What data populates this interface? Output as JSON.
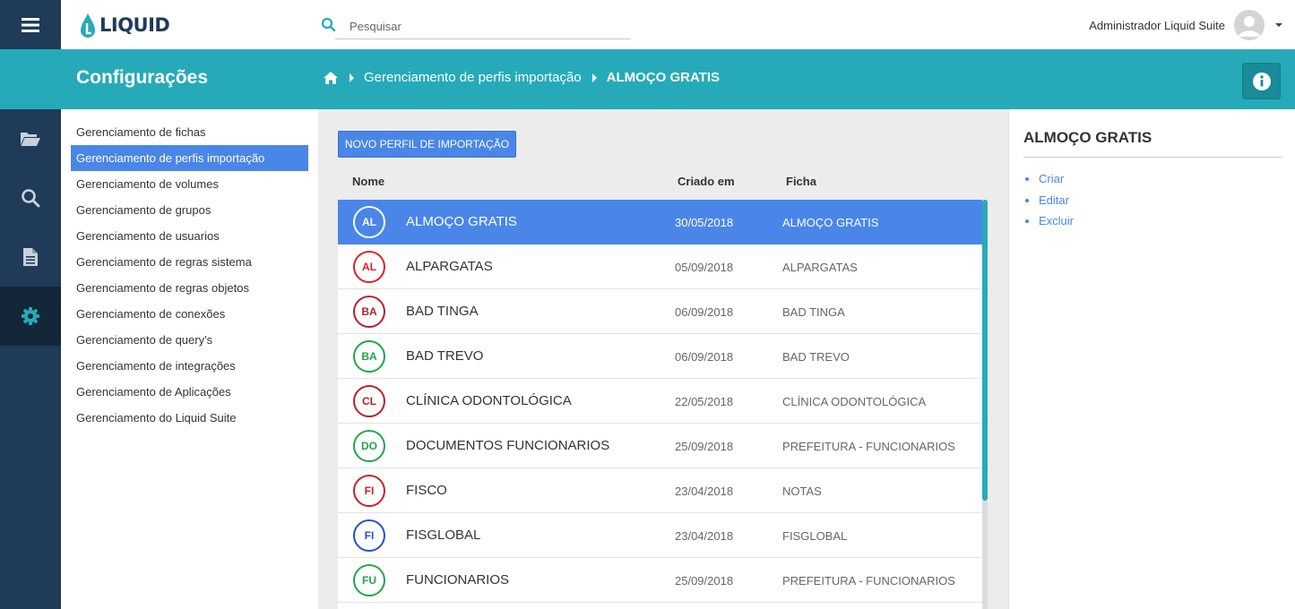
{
  "app": {
    "logo_text": "LIQUID"
  },
  "search": {
    "placeholder": "Pesquisar"
  },
  "user": {
    "name": "Administrador Liquid Suite"
  },
  "header": {
    "title": "Configurações",
    "breadcrumb": [
      "Gerenciamento de perfis importação",
      "ALMOÇO GRATIS"
    ]
  },
  "rail": [
    {
      "icon": "folder-icon"
    },
    {
      "icon": "search-icon"
    },
    {
      "icon": "document-icon"
    },
    {
      "icon": "gear-icon",
      "active": true
    }
  ],
  "submenu": [
    "Gerenciamento de fichas",
    "Gerenciamento de perfis importação",
    "Gerenciamento de volumes",
    "Gerenciamento de grupos",
    "Gerenciamento de usuarios",
    "Gerenciamento de regras sistema",
    "Gerenciamento de regras objetos",
    "Gerenciamento de conexões",
    "Gerenciamento de query's",
    "Gerenciamento de integrações",
    "Gerenciamento de Aplicações",
    "Gerenciamento do Liquid Suite"
  ],
  "submenu_active": 1,
  "main": {
    "new_button": "NOVO PERFIL DE IMPORTAÇÃO",
    "columns": {
      "name": "Nome",
      "created": "Criado em",
      "ficha": "Ficha"
    },
    "rows": [
      {
        "initials": "AL",
        "name": "ALMOÇO GRATIS",
        "date": "30/05/2018",
        "ficha": "ALMOÇO GRATIS",
        "color": "#4a86e8",
        "selected": true
      },
      {
        "initials": "AL",
        "name": "ALPARGATAS",
        "date": "05/09/2018",
        "ficha": "ALPARGATAS",
        "color": "#d9232a"
      },
      {
        "initials": "BA",
        "name": "BAD TINGA",
        "date": "06/09/2018",
        "ficha": "BAD TINGA",
        "color": "#b5222a"
      },
      {
        "initials": "BA",
        "name": "BAD TREVO",
        "date": "06/09/2018",
        "ficha": "BAD TREVO",
        "color": "#22a64a"
      },
      {
        "initials": "CL",
        "name": "CLÍNICA ODONTOLÓGICA",
        "date": "22/05/2018",
        "ficha": "CLÍNICA ODONTOLÓGICA",
        "color": "#b5222a"
      },
      {
        "initials": "DO",
        "name": "DOCUMENTOS FUNCIONARIOS",
        "date": "25/09/2018",
        "ficha": "PREFEITURA - FUNCIONARIOS",
        "color": "#22a64a"
      },
      {
        "initials": "FI",
        "name": "FISCO",
        "date": "23/04/2018",
        "ficha": "NOTAS",
        "color": "#c8202a"
      },
      {
        "initials": "FI",
        "name": "FISGLOBAL",
        "date": "23/04/2018",
        "ficha": "FISGLOBAL",
        "color": "#2350d4"
      },
      {
        "initials": "FU",
        "name": "FUNCIONARIOS",
        "date": "25/09/2018",
        "ficha": "PREFEITURA - FUNCIONARIOS",
        "color": "#22a64a"
      }
    ]
  },
  "right": {
    "title": "ALMOÇO GRATIS",
    "actions": [
      "Criar",
      "Editar",
      "Excluir"
    ]
  },
  "colors": {
    "primary": "#26aab9",
    "dark": "#1f3b57",
    "accent": "#4a86e8"
  }
}
